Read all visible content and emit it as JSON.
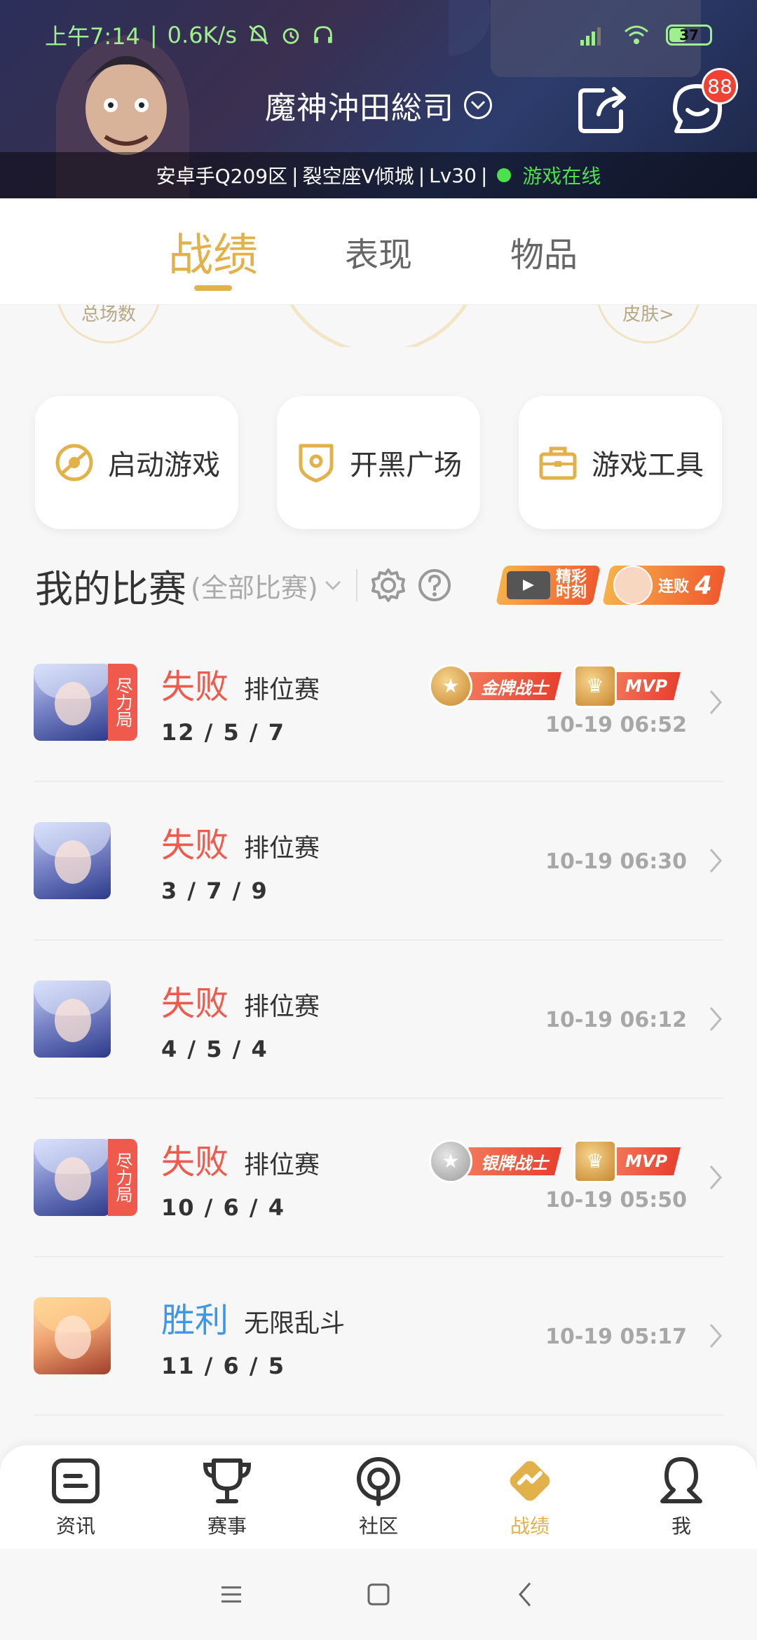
{
  "status_bar": {
    "time": "上午7:14",
    "network_speed": "0.6K/s",
    "battery": "37",
    "colors": {
      "text": "#9ff08d"
    }
  },
  "header": {
    "player_name": "魔神沖田総司",
    "chat_badge": "88",
    "server": "安卓手Q209区",
    "team": "裂空座V倾城",
    "level": "Lv30",
    "online_status": "游戏在线",
    "icons": [
      "share-icon",
      "chat-icon",
      "dropdown-icon"
    ]
  },
  "tabs": [
    {
      "label": "战绩",
      "active": true
    },
    {
      "label": "表现",
      "active": false
    },
    {
      "label": "物品",
      "active": false
    }
  ],
  "stats_peek": {
    "left_label": "总场数",
    "right_label": "皮肤>"
  },
  "quick_actions": [
    {
      "label": "启动游戏",
      "icon": "launch-icon"
    },
    {
      "label": "开黑广场",
      "icon": "shield-icon"
    },
    {
      "label": "游戏工具",
      "icon": "toolbox-icon"
    }
  ],
  "matches_section": {
    "title": "我的比赛",
    "filter": "(全部比赛)",
    "highlight_banner": {
      "line1": "精彩",
      "line2": "时刻"
    },
    "streak_banner": {
      "label": "连败",
      "count": "4"
    }
  },
  "matches": [
    {
      "result": "失败",
      "result_type": "lose",
      "mode": "排位赛",
      "kda": "12 / 5 / 7",
      "time": "10-19 06:52",
      "effort_tag": "尽力局",
      "awards": [
        "金牌战士",
        "MVP"
      ],
      "avatar": "hero-silver"
    },
    {
      "result": "失败",
      "result_type": "lose",
      "mode": "排位赛",
      "kda": "3 / 7 / 9",
      "time": "10-19 06:30",
      "effort_tag": "",
      "awards": [],
      "avatar": "hero-silver"
    },
    {
      "result": "失败",
      "result_type": "lose",
      "mode": "排位赛",
      "kda": "4 / 5 / 4",
      "time": "10-19 06:12",
      "effort_tag": "",
      "awards": [],
      "avatar": "hero-silver"
    },
    {
      "result": "失败",
      "result_type": "lose",
      "mode": "排位赛",
      "kda": "10 / 6 / 4",
      "time": "10-19 05:50",
      "effort_tag": "尽力局",
      "awards": [
        "银牌战士",
        "MVP"
      ],
      "avatar": "hero-silver"
    },
    {
      "result": "胜利",
      "result_type": "win",
      "mode": "无限乱斗",
      "kda": "11 / 6 / 5",
      "time": "10-19 05:17",
      "effort_tag": "",
      "awards": [],
      "avatar": "hero-gold"
    }
  ],
  "bottom_nav": [
    {
      "label": "资讯",
      "icon": "news-icon",
      "active": false
    },
    {
      "label": "赛事",
      "icon": "trophy-icon",
      "active": false
    },
    {
      "label": "社区",
      "icon": "community-icon",
      "active": false
    },
    {
      "label": "战绩",
      "icon": "record-icon",
      "active": true
    },
    {
      "label": "我",
      "icon": "profile-icon",
      "active": false
    }
  ],
  "colors": {
    "accent": "#e2b14a",
    "lose": "#ee5a4b",
    "win": "#3d97e6",
    "online": "#4ce04c",
    "badge": "#f04135"
  }
}
